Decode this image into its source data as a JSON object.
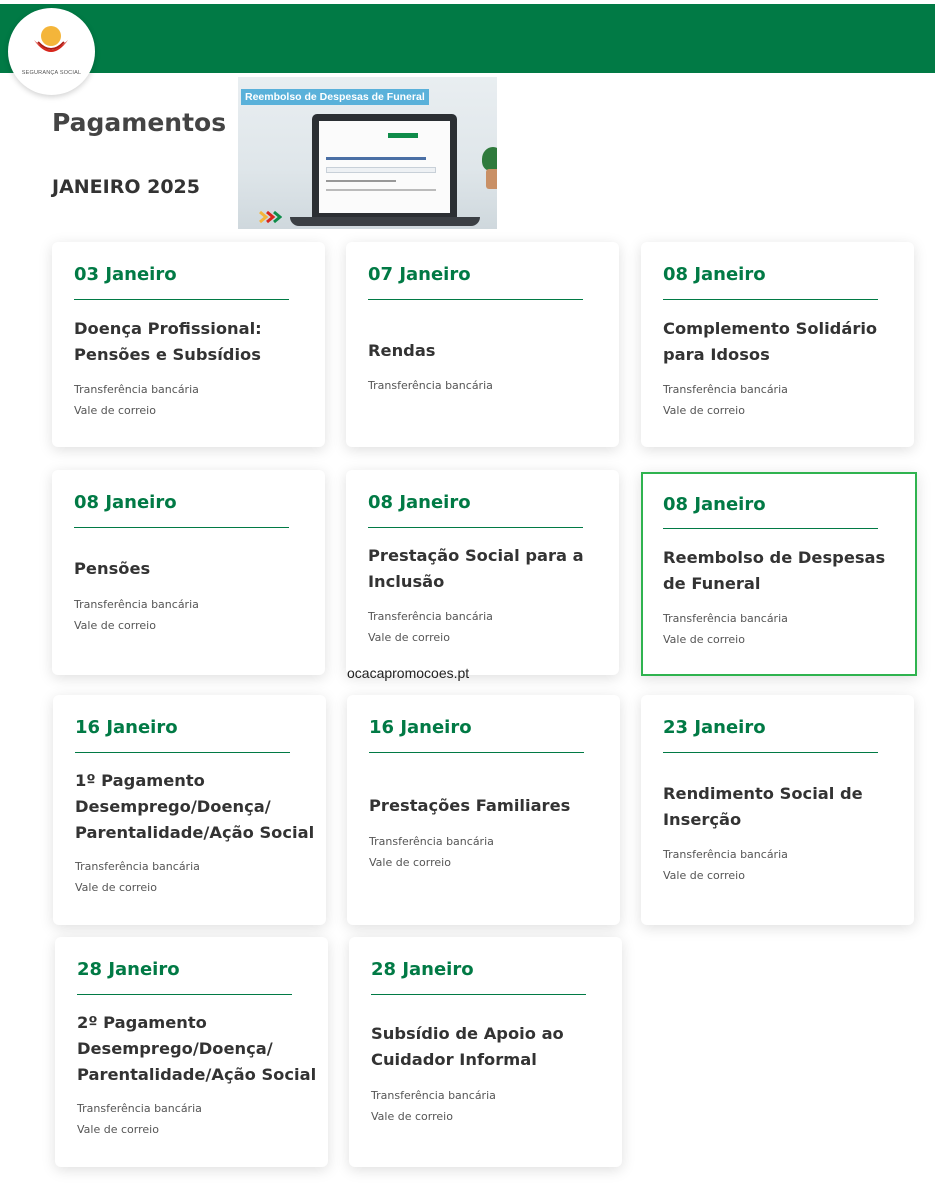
{
  "header": {
    "logo_text": "SEGURANÇA SOCIAL",
    "brand_color": "#017a45"
  },
  "page": {
    "title": "Pagamentos",
    "subtitle": "JANEIRO 2025"
  },
  "banner": {
    "title": "Reembolso de Despesas de Funeral"
  },
  "watermark": "ocacapromocoes.pt",
  "cards": [
    {
      "date": "03 Janeiro",
      "name_lines": [
        "Doença Profissional:",
        "Pensões e Subsídios"
      ],
      "methods": [
        "Transferência bancária",
        "Vale de correio"
      ]
    },
    {
      "date": "07 Janeiro",
      "name_lines": [
        "Rendas"
      ],
      "methods": [
        "Transferência bancária"
      ]
    },
    {
      "date": "08 Janeiro",
      "name_lines": [
        "Complemento Solidário",
        "para Idosos"
      ],
      "methods": [
        "Transferência bancária",
        "Vale de correio"
      ]
    },
    {
      "date": "08 Janeiro",
      "name_lines": [
        "Pensões"
      ],
      "methods": [
        "Transferência bancária",
        "Vale de correio"
      ]
    },
    {
      "date": "08 Janeiro",
      "name_lines": [
        "Prestação Social para a",
        "Inclusão"
      ],
      "methods": [
        "Transferência bancária",
        "Vale de correio"
      ]
    },
    {
      "date": "08 Janeiro",
      "name_lines": [
        "Reembolso de Despesas",
        "de Funeral"
      ],
      "methods": [
        "Transferência bancária",
        "Vale de correio"
      ],
      "highlighted": true
    },
    {
      "date": "16 Janeiro",
      "name_lines": [
        "1º Pagamento",
        "Desemprego/Doença/",
        "Parentalidade/Ação Social"
      ],
      "methods": [
        "Transferência bancária",
        "Vale de correio"
      ]
    },
    {
      "date": "16 Janeiro",
      "name_lines": [
        "Prestações Familiares"
      ],
      "methods": [
        "Transferência bancária",
        "Vale de correio"
      ]
    },
    {
      "date": "23 Janeiro",
      "name_lines": [
        "Rendimento Social de",
        "Inserção"
      ],
      "methods": [
        "Transferência bancária",
        "Vale de correio"
      ]
    },
    {
      "date": "28 Janeiro",
      "name_lines": [
        "2º Pagamento",
        "Desemprego/Doença/",
        "Parentalidade/Ação Social"
      ],
      "methods": [
        "Transferência bancária",
        "Vale de correio"
      ]
    },
    {
      "date": "28 Janeiro",
      "name_lines": [
        "Subsídio de Apoio ao",
        "Cuidador Informal"
      ],
      "methods": [
        "Transferência bancária",
        "Vale de correio"
      ]
    }
  ]
}
